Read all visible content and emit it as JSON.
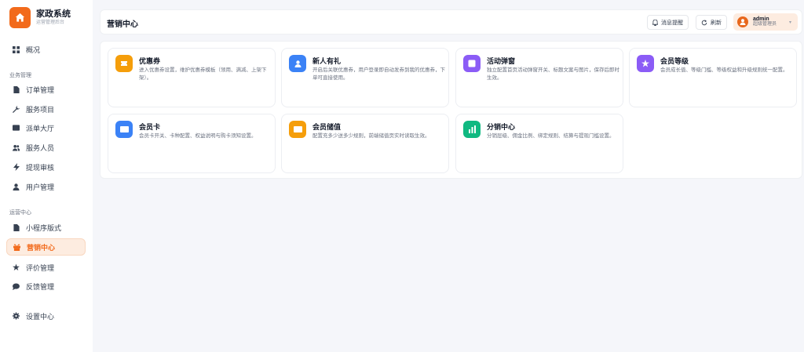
{
  "brand": {
    "title": "家政系统",
    "subtitle": "运营管理后台",
    "icon": "home-icon",
    "color": "#f26a1b"
  },
  "sidebar": {
    "items_top": [
      {
        "label": "概况",
        "icon": "dashboard-grid-icon"
      }
    ],
    "group_business": "业务管理",
    "items_business": [
      {
        "label": "订单管理",
        "icon": "document-icon"
      },
      {
        "label": "服务项目",
        "icon": "wrench-icon"
      },
      {
        "label": "派单大厅",
        "icon": "ticket-icon"
      },
      {
        "label": "服务人员",
        "icon": "users-icon"
      },
      {
        "label": "提现审核",
        "icon": "bolt-icon"
      },
      {
        "label": "用户管理",
        "icon": "user-icon"
      }
    ],
    "group_ops": "运营中心",
    "items_ops": [
      {
        "label": "小程序版式",
        "icon": "file-icon"
      },
      {
        "label": "营销中心",
        "icon": "gift-icon",
        "active": true
      },
      {
        "label": "评价管理",
        "icon": "star-icon"
      },
      {
        "label": "反馈管理",
        "icon": "chat-icon"
      }
    ],
    "items_bottom": [
      {
        "label": "设置中心",
        "icon": "gear-icon"
      }
    ]
  },
  "header": {
    "title": "营销中心",
    "notify_label": "消息提醒",
    "refresh_label": "刷新",
    "user_name": "admin",
    "user_role": "超级管理员"
  },
  "cards": [
    {
      "title": "优惠券",
      "desc": "进入优惠券设置，维护优惠券模板（领用、满减、上架下架）。",
      "icon": "ticket-icon",
      "color": "#f59e0b"
    },
    {
      "title": "新人有礼",
      "desc": "开启后关联优惠券，用户登录即自动发券到我的优惠券，下单可直接使用。",
      "icon": "user-icon",
      "color": "#3b82f6"
    },
    {
      "title": "活动弹窗",
      "desc": "独立配置首页活动弹窗开关、标题文案与图片，保存后即时生效。",
      "icon": "window-icon",
      "color": "#8b5cf6"
    },
    {
      "title": "会员等级",
      "desc": "会员成长值、等级门槛、等级权益和升级规则统一配置。",
      "icon": "star-icon",
      "color": "#8b5cf6"
    },
    {
      "title": "会员卡",
      "desc": "会员卡开关、卡种配置、权益说明与购卡须知设置。",
      "icon": "card-icon",
      "color": "#3b82f6"
    },
    {
      "title": "会员储值",
      "desc": "配置充多少送多少规则，前端储值页实时读取生效。",
      "icon": "wallet-icon",
      "color": "#f59e0b"
    },
    {
      "title": "分销中心",
      "desc": "分销层级、佣金比例、绑定规则、结算与提现门槛设置。",
      "icon": "chart-icon",
      "color": "#10b981"
    }
  ]
}
